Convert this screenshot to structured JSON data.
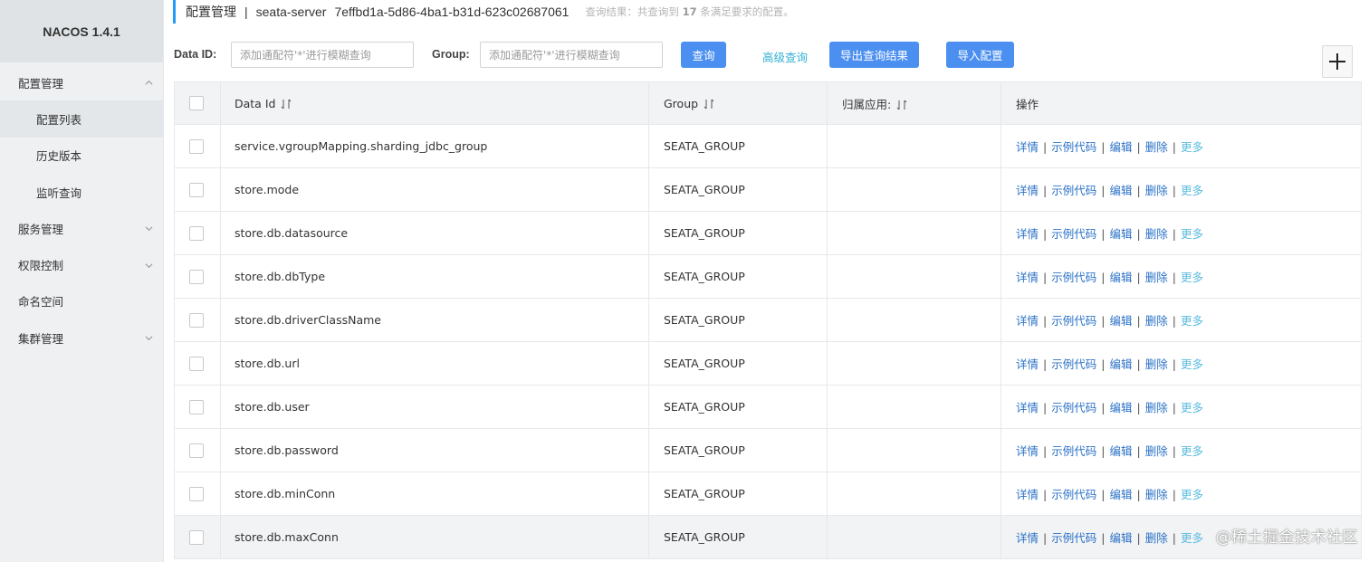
{
  "brand": "NACOS 1.4.1",
  "sidebar": {
    "items": [
      {
        "label": "配置管理",
        "expanded": true
      },
      {
        "label": "配置列表"
      },
      {
        "label": "历史版本"
      },
      {
        "label": "监听查询"
      },
      {
        "label": "服务管理",
        "expanded": false
      },
      {
        "label": "权限控制",
        "expanded": false
      },
      {
        "label": "命名空间"
      },
      {
        "label": "集群管理",
        "expanded": false
      }
    ]
  },
  "header": {
    "title": "配置管理",
    "separator": "|",
    "namespace": "seata-server",
    "namespace_id": "7effbd1a-5d86-4ba1-b31d-623c02687061",
    "result_prefix": "查询结果：共查询到",
    "result_count": "17",
    "result_suffix": "条满足要求的配置。"
  },
  "search": {
    "dataid_label": "Data ID:",
    "dataid_placeholder": "添加通配符'*'进行模糊查询",
    "group_label": "Group:",
    "group_placeholder": "添加通配符'*'进行模糊查询",
    "query_button": "查询",
    "advanced_link": "高级查询",
    "export_button": "导出查询结果",
    "import_button": "导入配置"
  },
  "table": {
    "columns": [
      "Data Id",
      "Group",
      "归属应用:",
      "操作"
    ],
    "rows": [
      {
        "data_id": "service.vgroupMapping.sharding_jdbc_group",
        "group": "SEATA_GROUP",
        "app": ""
      },
      {
        "data_id": "store.mode",
        "group": "SEATA_GROUP",
        "app": ""
      },
      {
        "data_id": "store.db.datasource",
        "group": "SEATA_GROUP",
        "app": ""
      },
      {
        "data_id": "store.db.dbType",
        "group": "SEATA_GROUP",
        "app": ""
      },
      {
        "data_id": "store.db.driverClassName",
        "group": "SEATA_GROUP",
        "app": ""
      },
      {
        "data_id": "store.db.url",
        "group": "SEATA_GROUP",
        "app": ""
      },
      {
        "data_id": "store.db.user",
        "group": "SEATA_GROUP",
        "app": ""
      },
      {
        "data_id": "store.db.password",
        "group": "SEATA_GROUP",
        "app": ""
      },
      {
        "data_id": "store.db.minConn",
        "group": "SEATA_GROUP",
        "app": ""
      },
      {
        "data_id": "store.db.maxConn",
        "group": "SEATA_GROUP",
        "app": ""
      }
    ],
    "actions": [
      "详情",
      "示例代码",
      "编辑",
      "删除",
      "更多"
    ],
    "action_separator": "|"
  },
  "watermark": "@稀土掘金技术社区",
  "colors": {
    "primary": "#4b8ff0",
    "link": "#2b72c6",
    "accent": "#209bfa"
  },
  "icons": {
    "plus": "plus-icon",
    "chevron_up": "chevron-up-icon",
    "chevron_down": "chevron-down-icon",
    "sort": "sort-icon"
  }
}
